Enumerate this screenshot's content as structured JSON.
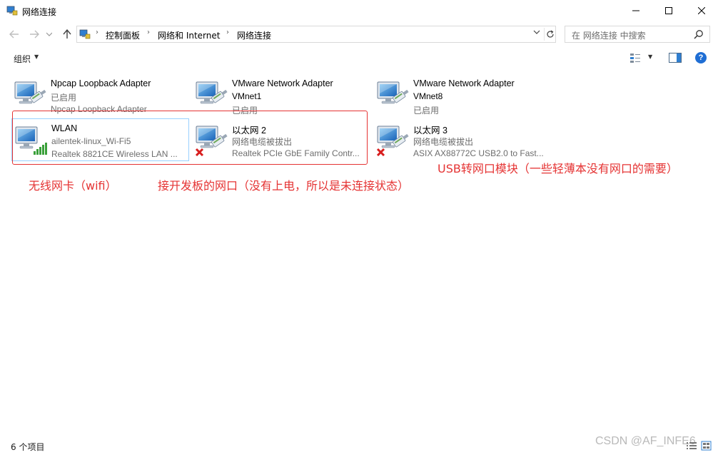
{
  "window": {
    "title": "网络连接",
    "icon": "network-connections-icon"
  },
  "address": {
    "crumbs": [
      "控制面板",
      "网络和 Internet",
      "网络连接"
    ]
  },
  "search": {
    "placeholder": "在 网络连接 中搜索"
  },
  "toolbar": {
    "organize_label": "组织"
  },
  "items": [
    {
      "name": "Npcap Loopback Adapter",
      "line2": "已启用",
      "line3": "Npcap Loopback Adapter",
      "icon": "network-adapter-icon",
      "status": "enabled"
    },
    {
      "name": "VMware Network Adapter VMnet1",
      "name_line1": "VMware Network Adapter",
      "name_line2": "VMnet1",
      "line2": "已启用",
      "icon": "network-adapter-icon",
      "status": "enabled"
    },
    {
      "name": "VMware Network Adapter VMnet8",
      "name_line1": "VMware Network Adapter",
      "name_line2": "VMnet8",
      "line2": "已启用",
      "icon": "network-adapter-icon",
      "status": "enabled"
    },
    {
      "name": "WLAN",
      "line2": "ailentek-linux_Wi-Fi5",
      "line3": "Realtek 8821CE Wireless LAN ...",
      "icon": "wireless-adapter-icon",
      "status": "connected",
      "selected": true
    },
    {
      "name": "以太网 2",
      "line2": "网络电缆被拔出",
      "line3": "Realtek PCIe GbE Family Contr...",
      "icon": "network-adapter-icon",
      "status": "disconnected"
    },
    {
      "name": "以太网 3",
      "line2": "网络电缆被拔出",
      "line3": "ASIX AX88772C USB2.0 to Fast...",
      "icon": "network-adapter-icon",
      "status": "disconnected"
    }
  ],
  "annotations": {
    "wifi": "无线网卡（wifi）",
    "ethernet": "接开发板的网口（没有上电，所以是未连接状态）",
    "usb": "USB转网口模块（一些轻薄本没有网口的需要）",
    "color": "#e53333"
  },
  "status": {
    "count": "6 个项目"
  },
  "watermark": "CSDN @AF_INFE6"
}
